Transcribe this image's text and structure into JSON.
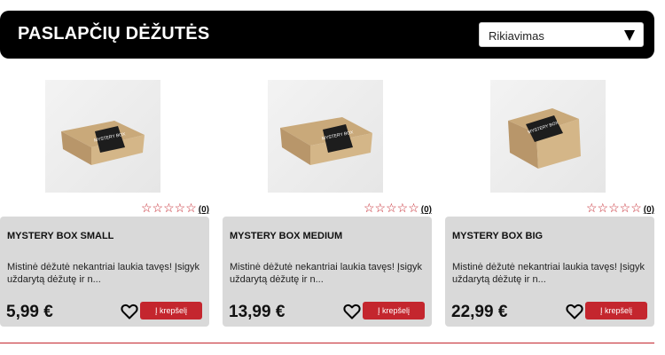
{
  "header": {
    "title": "PASLAPČIŲ DĖŽUTĖS",
    "sort_label": "Rikiavimas"
  },
  "products": [
    {
      "name": "MYSTERY BOX SMALL",
      "description": "Mistinė dėžutė nekantriai laukia tavęs! Įsigyk uždarytą dėžutę ir n...",
      "price": "5,99 €",
      "rating_stars": "☆☆☆☆☆",
      "rating_count": "(0)",
      "cart_label": "Į krepšelį",
      "box_label": "MYSTERY BOX"
    },
    {
      "name": "MYSTERY BOX MEDIUM",
      "description": "Mistinė dėžutė nekantriai laukia tavęs! Įsigyk uždarytą dėžutę ir n...",
      "price": "13,99 €",
      "rating_stars": "☆☆☆☆☆",
      "rating_count": "(0)",
      "cart_label": "Į krepšelį",
      "box_label": "MYSTERY BOX"
    },
    {
      "name": "MYSTERY BOX BIG",
      "description": "Mistinė dėžutė nekantriai laukia tavęs! Įsigyk uždarytą dėžutę ir n...",
      "price": "22,99 €",
      "rating_stars": "☆☆☆☆☆",
      "rating_count": "(0)",
      "cart_label": "Į krepšelį",
      "box_label": "MYSTERY BOX"
    }
  ],
  "colors": {
    "accent": "#c4262e",
    "header_bg": "#000000",
    "card_bg": "#d9d9d9"
  }
}
